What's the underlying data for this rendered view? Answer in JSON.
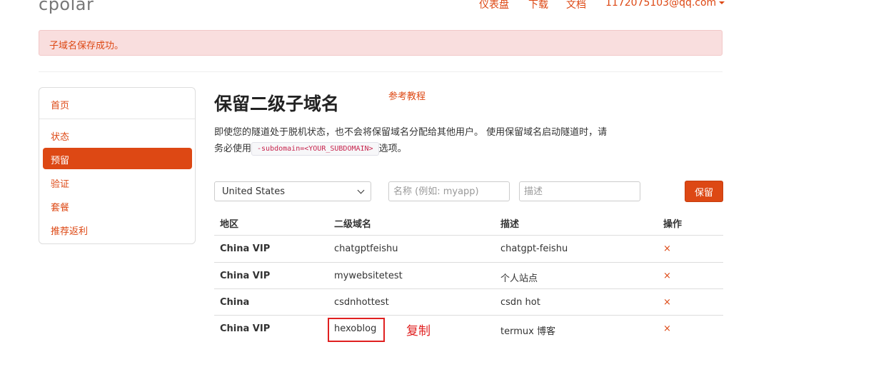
{
  "header": {
    "brand": "cpolar",
    "nav": [
      "仪表盘",
      "下载",
      "文档"
    ],
    "account": "1172075103@qq.com"
  },
  "alert": {
    "text": "子域名保存成功。"
  },
  "sidebar": {
    "items": [
      {
        "label": "首页"
      },
      {
        "label": "状态"
      },
      {
        "label": "预留"
      },
      {
        "label": "验证"
      },
      {
        "label": "套餐"
      },
      {
        "label": "推荐返利"
      }
    ],
    "active_index": 2
  },
  "main": {
    "title": "保留二级子域名",
    "tutorial_link": "参考教程",
    "desc_part1": "即使您的隧道处于脱机状态，也不会将保留域名分配给其他用户。 使用保留域名启动隧道时，请务必使用",
    "desc_code": "-subdomain=<YOUR_SUBDOMAIN>",
    "desc_part2": "选项。"
  },
  "form": {
    "region_value": "United States",
    "name_placeholder": "名称 (例如: myapp)",
    "desc_placeholder": "描述",
    "save_label": "保留"
  },
  "table": {
    "headers": [
      "地区",
      "二级域名",
      "描述",
      "操作"
    ],
    "rows": [
      {
        "region": "China VIP",
        "subdomain": "chatgptfeishu",
        "desc": "chatgpt-feishu",
        "action": "×"
      },
      {
        "region": "China VIP",
        "subdomain": "mywebsitetest",
        "desc": "个人站点",
        "action": "×"
      },
      {
        "region": "China",
        "subdomain": "csdnhottest",
        "desc": "csdn hot",
        "action": "×"
      },
      {
        "region": "China VIP",
        "subdomain": "hexoblog",
        "desc": "termux 博客",
        "action": "×"
      }
    ]
  },
  "annotation": {
    "text": "复制"
  },
  "colors": {
    "accent": "#dd4814",
    "alert_bg": "#f9dede",
    "annotation": "#e02020"
  }
}
